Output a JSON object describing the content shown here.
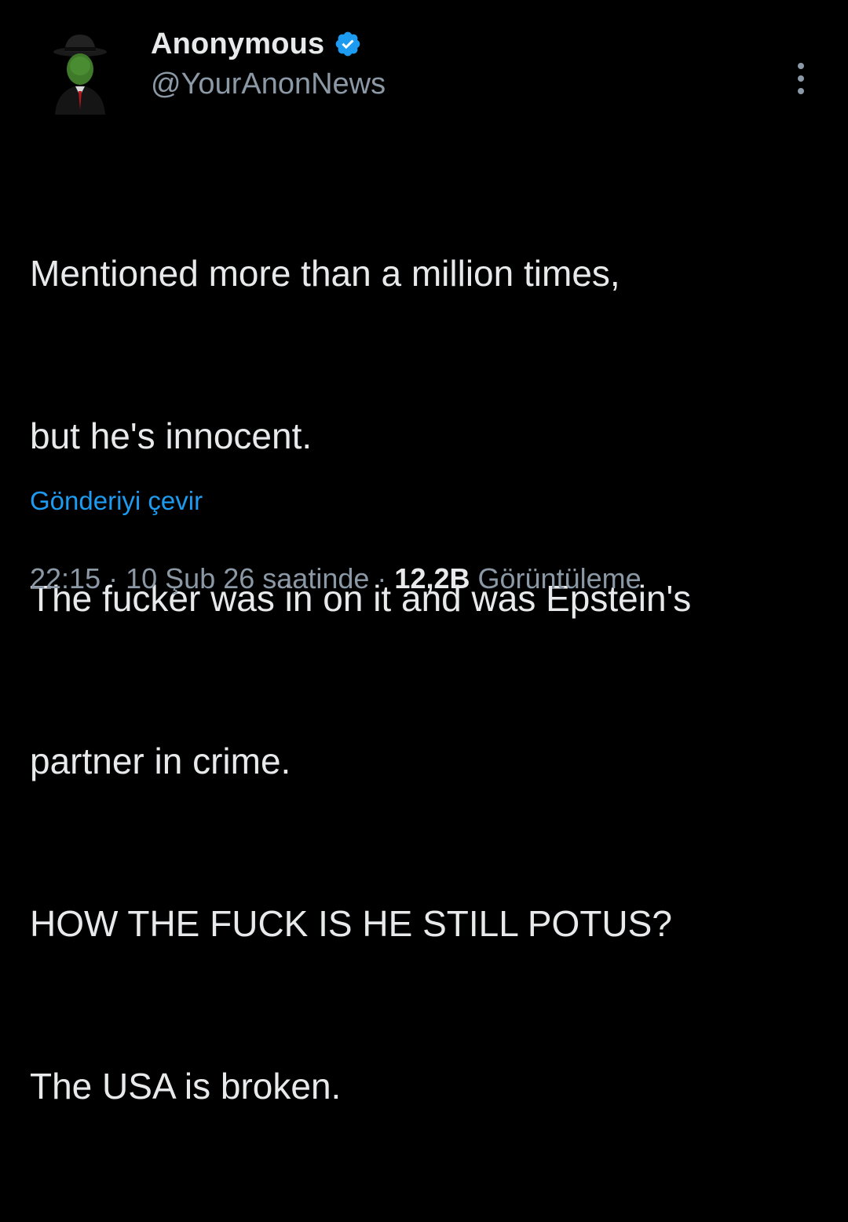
{
  "author": {
    "display_name": "Anonymous",
    "handle": "@YourAnonNews",
    "verified": true,
    "verified_color": "#1d9bf0"
  },
  "tweet": {
    "lines": [
      "Mentioned more than a million times,",
      "but he's innocent.",
      "The fucker was in on it and was Epstein's",
      "partner in crime.",
      "HOW THE FUCK IS HE STILL POTUS?",
      "The USA is broken."
    ]
  },
  "translate_label": "Gönderiyi çevir",
  "meta": {
    "time": "22:15",
    "separator": "·",
    "date": "10 Şub 26 saatinde",
    "views_count": "12,2B",
    "views_label": "Görüntüleme"
  },
  "icons": {
    "more": "more-vertical-icon",
    "verified": "verified-badge-icon"
  },
  "colors": {
    "background": "#000000",
    "text_primary": "#e7e9ea",
    "text_secondary": "#8b98a5",
    "link": "#1d9bf0"
  }
}
